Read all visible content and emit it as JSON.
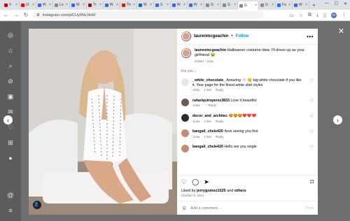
{
  "browser": {
    "tabs": [
      {
        "label": "V",
        "color": "#cc0000"
      },
      {
        "label": "(2",
        "color": "#ff0000"
      },
      {
        "label": "W",
        "color": "#3a6fd1"
      },
      {
        "label": "Lu",
        "color": "#888888"
      },
      {
        "label": "W",
        "color": "#3a6fd1"
      },
      {
        "label": "Tr",
        "color": "#8a1a1a"
      },
      {
        "label": "W",
        "color": "#3a6fd1"
      },
      {
        "label": "Th",
        "color": "#cc2200"
      },
      {
        "label": "W",
        "color": "#1565c0"
      },
      {
        "label": "S",
        "color": "#3a6fd1"
      },
      {
        "label": "W",
        "color": "#3a6fd1"
      },
      {
        "label": "W",
        "color": "#3a6fd1"
      },
      {
        "label": "G",
        "color": "#888888"
      },
      {
        "label": "G",
        "color": "#888888"
      },
      {
        "label": "G",
        "color": "#888888"
      },
      {
        "label": "G",
        "color": "#888888"
      },
      {
        "label": "Fa",
        "color": "#1877f2"
      },
      {
        "label": "W",
        "color": "#3a6fd1"
      }
    ],
    "active_tab_label": "",
    "url": "instagram.com/p/CUy0Nv1fnR/",
    "profile_initial": "M"
  },
  "post": {
    "username": "laurenmcgeachin",
    "follow_label": "Follow",
    "caption": "Halloween costume idea: I'll dress up as your girlfriend 😅",
    "caption_meta": "Edited · 111w",
    "for_you": "For you",
    "comments": [
      {
        "user": "_white_chocolate_",
        "text": "Amazing 🤍 😊 tag white chocolate if you like it. Your page for the finest white shirt styles",
        "time": "110w",
        "likes": "1 like",
        "reply": "Reply",
        "color": "#e8e6e0"
      },
      {
        "user": "rafaelquiroperez3833",
        "text": "Love it beautiful",
        "time": "113w",
        "likes": "",
        "reply": "Reply",
        "color": "#6d5b4c"
      },
      {
        "user": "decor_and_architec",
        "text": "😍😍😍❤️❤️❤️",
        "time": "114w",
        "likes": "1 like",
        "reply": "Reply",
        "color": "#2b2b2b"
      },
      {
        "user": "bangali_chele420",
        "text": "Ilove seeing you first",
        "time": "114w",
        "likes": "1 like",
        "reply": "Reply",
        "color": "#c48b7a"
      },
      {
        "user": "bangali_chele420",
        "text": "Hello are you single",
        "time": "",
        "likes": "",
        "reply": "",
        "color": "#c48b7a"
      }
    ],
    "liked_by_prefix": "Liked by",
    "liked_by_user": "jerrygomez1025",
    "liked_by_suffix": "and",
    "liked_by_others": "others",
    "date": "October 9, 2021",
    "add_comment_placeholder": "Add a comment...",
    "post_label": "Post"
  }
}
